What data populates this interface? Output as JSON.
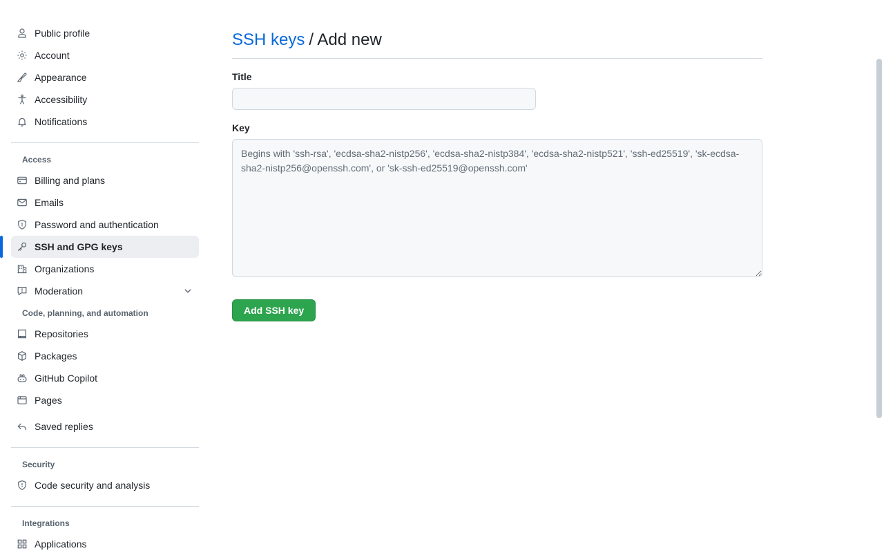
{
  "sidebar": {
    "groups": [
      {
        "title": null,
        "items": [
          {
            "label": "Public profile",
            "icon": "person-icon",
            "selected": false,
            "chevron": false
          },
          {
            "label": "Account",
            "icon": "gear-icon",
            "selected": false,
            "chevron": false
          },
          {
            "label": "Appearance",
            "icon": "paintbrush-icon",
            "selected": false,
            "chevron": false
          },
          {
            "label": "Accessibility",
            "icon": "accessibility-icon",
            "selected": false,
            "chevron": false
          },
          {
            "label": "Notifications",
            "icon": "bell-icon",
            "selected": false,
            "chevron": false
          }
        ]
      },
      {
        "title": "Access",
        "items": [
          {
            "label": "Billing and plans",
            "icon": "credit-card-icon",
            "selected": false,
            "chevron": false
          },
          {
            "label": "Emails",
            "icon": "mail-icon",
            "selected": false,
            "chevron": false
          },
          {
            "label": "Password and authentication",
            "icon": "shield-lock-icon",
            "selected": false,
            "chevron": false
          },
          {
            "label": "SSH and GPG keys",
            "icon": "key-icon",
            "selected": true,
            "chevron": false
          },
          {
            "label": "Organizations",
            "icon": "organization-icon",
            "selected": false,
            "chevron": false
          },
          {
            "label": "Moderation",
            "icon": "report-icon",
            "selected": false,
            "chevron": true
          }
        ]
      },
      {
        "title": "Code, planning, and automation",
        "items": [
          {
            "label": "Repositories",
            "icon": "repo-icon",
            "selected": false,
            "chevron": false
          },
          {
            "label": "Packages",
            "icon": "package-icon",
            "selected": false,
            "chevron": false
          },
          {
            "label": "GitHub Copilot",
            "icon": "copilot-icon",
            "selected": false,
            "chevron": false
          },
          {
            "label": "Pages",
            "icon": "browser-icon",
            "selected": false,
            "chevron": false
          }
        ]
      },
      {
        "title": null,
        "items": [
          {
            "label": "Saved replies",
            "icon": "reply-icon",
            "selected": false,
            "chevron": false
          }
        ]
      },
      {
        "title": "Security",
        "items": [
          {
            "label": "Code security and analysis",
            "icon": "shield-check-icon",
            "selected": false,
            "chevron": false
          }
        ]
      },
      {
        "title": "Integrations",
        "items": [
          {
            "label": "Applications",
            "icon": "apps-grid-icon",
            "selected": false,
            "chevron": false
          }
        ]
      }
    ]
  },
  "main": {
    "heading": {
      "link_text": "SSH keys",
      "rest_text": "/ Add new"
    },
    "title_field": {
      "label": "Title",
      "value": "",
      "placeholder": ""
    },
    "key_field": {
      "label": "Key",
      "value": "",
      "placeholder": "Begins with 'ssh-rsa', 'ecdsa-sha2-nistp256', 'ecdsa-sha2-nistp384', 'ecdsa-sha2-nistp521', 'ssh-ed25519', 'sk-ecdsa-sha2-nistp256@openssh.com', or 'sk-ssh-ed25519@openssh.com'"
    },
    "submit_label": "Add SSH key"
  },
  "colors": {
    "accent_link": "#0969da",
    "selected_bar": "#0969da",
    "primary_button": "#2da44e",
    "field_bg": "#f6f8fa",
    "border": "#d1d9e0"
  }
}
